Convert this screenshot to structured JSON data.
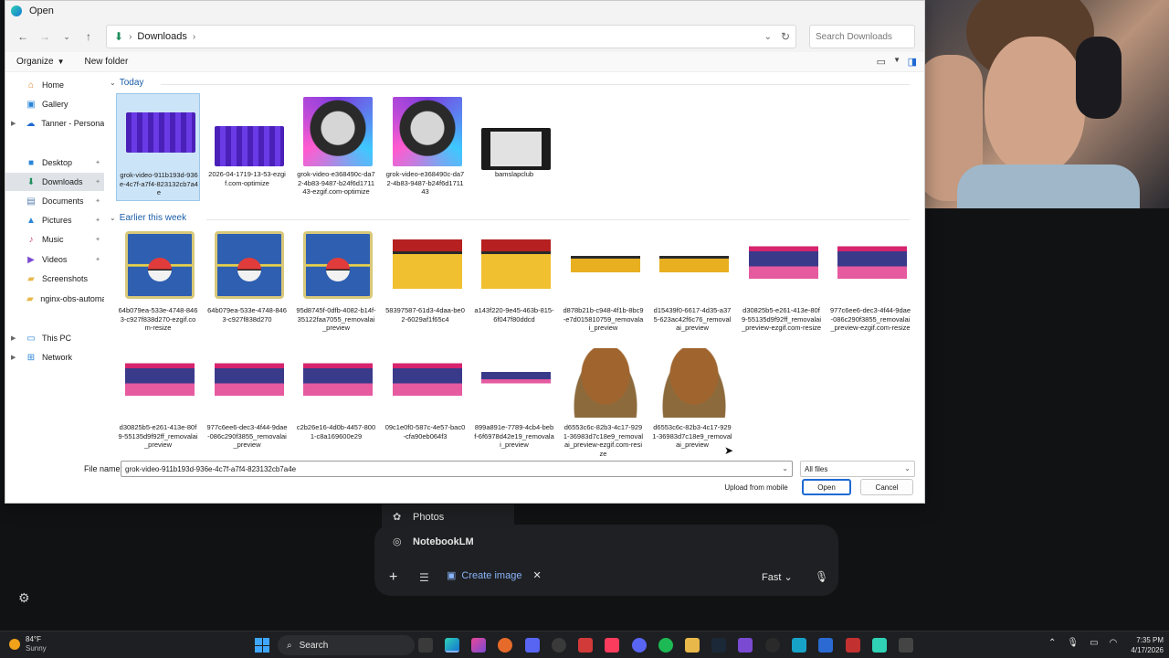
{
  "window": {
    "title": "Open"
  },
  "address": {
    "location": "Downloads",
    "search_placeholder": "Search Downloads"
  },
  "command_bar": {
    "organize": "Organize",
    "new_folder": "New folder"
  },
  "nav_pane": [
    {
      "label": "Home",
      "icon": "home-icon"
    },
    {
      "label": "Gallery",
      "icon": "gallery-icon"
    },
    {
      "label": "Tanner - Personal",
      "icon": "cloud-icon"
    },
    {
      "label": "Desktop",
      "icon": "desktop-icon"
    },
    {
      "label": "Downloads",
      "icon": "download-icon"
    },
    {
      "label": "Documents",
      "icon": "documents-icon"
    },
    {
      "label": "Pictures",
      "icon": "pictures-icon"
    },
    {
      "label": "Music",
      "icon": "music-icon"
    },
    {
      "label": "Videos",
      "icon": "videos-icon"
    },
    {
      "label": "Screenshots",
      "icon": "folder-icon"
    },
    {
      "label": "nginx-obs-automat",
      "icon": "folder-icon"
    },
    {
      "label": "This PC",
      "icon": "pc-icon"
    },
    {
      "label": "Network",
      "icon": "network-icon"
    }
  ],
  "groups": {
    "today": "Today",
    "earlier": "Earlier this week"
  },
  "files_today": [
    {
      "name": "grok-video-911b193d-936e-4c7f-a7f4-823132cb7a4e",
      "thumb": "purple-video"
    },
    {
      "name": "2026-04-1719-13-53-ezgif.com-optimize",
      "thumb": "purple"
    },
    {
      "name": "grok-video-e368490c-da72-4b83-9487-b24f6d171143-ezgif.com-optimize",
      "thumb": "portrait"
    },
    {
      "name": "grok-video-e368490c-da72-4b83-9487-b24f6d171143",
      "thumb": "portrait"
    },
    {
      "name": "bamslapclub",
      "thumb": "video"
    }
  ],
  "files_week_row1": [
    {
      "name": "64b079ea-533e-4748-8463-c927f838d270-ezgif.com-resize",
      "thumb": "pokecard"
    },
    {
      "name": "64b079ea-533e-4748-8463-c927f838d270",
      "thumb": "pokecard"
    },
    {
      "name": "95d8745f-0dfb-4082-b14f-35122faa7055_removalai_preview",
      "thumb": "pokecard"
    },
    {
      "name": "58397587-61d3-4daa-be02-6029af1f65c4",
      "thumb": "logo-red"
    },
    {
      "name": "a143f220-9e45-463b-815-6f047f80ddcd",
      "thumb": "logo-red"
    },
    {
      "name": "d878b21b-c948-4f1b-8bc9-e7d015810759_removalai_preview",
      "thumb": "logo-small"
    },
    {
      "name": "d15439f0-6617-4d35-a375-623ac42f6c76_removalai_preview",
      "thumb": "logo-small"
    },
    {
      "name": "d30825b5-e261-413e-80f9-55135d9f92ff_removalai_preview-ezgif.com-resize",
      "thumb": "prism"
    },
    {
      "name": "977c6ee6-dec3-4f44-9dae-086c290f3855_removalai_preview-ezgif.com-resize",
      "thumb": "prism"
    }
  ],
  "files_week_row2": [
    {
      "name": "d30825b5-e261-413e-80f9-55135d9f92ff_removalai_preview",
      "thumb": "prism"
    },
    {
      "name": "977c6ee6-dec3-4f44-9dae-086c290f3855_removalai_preview",
      "thumb": "prism"
    },
    {
      "name": "c2b26e16-4d0b-4457-8001-c8a169600e29",
      "thumb": "prism"
    },
    {
      "name": "09c1e0f0-587c-4e57-bac0-cfa90eb064f3",
      "thumb": "prism"
    },
    {
      "name": "899a891e-7789-4cb4-bebf-6f6978d42e19_removalai_preview",
      "thumb": "prism-small"
    },
    {
      "name": "d6553c6c-82b3-4c17-9291-36983d7c18e9_removalai_preview-ezgif.com-resize",
      "thumb": "diglett"
    },
    {
      "name": "d6553c6c-82b3-4c17-9291-36983d7c18e9_removalai_preview",
      "thumb": "diglett"
    }
  ],
  "footer": {
    "file_name_label": "File name:",
    "file_name_value": "grok-video-911b193d-936e-4c7f-a7f4-823132cb7a4e",
    "filter": "All files",
    "upload": "Upload from mobile",
    "open": "Open",
    "cancel": "Cancel"
  },
  "background_app": {
    "menu": [
      {
        "label": "Photos",
        "icon": "photos-icon"
      },
      {
        "label": "NotebookLM",
        "icon": "notebook-icon"
      }
    ],
    "chip": "Create image",
    "mode": "Fast"
  },
  "taskbar": {
    "weather_temp": "84°F",
    "weather_cond": "Sunny",
    "search": "Search",
    "time": "7:35 PM",
    "date": "4/17/2026"
  },
  "colors": {
    "accent": "#1e6ad2",
    "selection": "#cce4f7",
    "chip": "#8ab4f8"
  }
}
